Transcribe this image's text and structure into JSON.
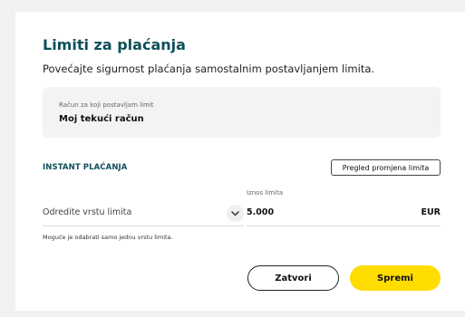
{
  "modal": {
    "title": "Limiti za plaćanja",
    "subtitle": "Povećajte sigurnost plaćanja samostalnim postavljanjem limita."
  },
  "account": {
    "label": "Račun za koji postavljam limit",
    "value": "Moj tekući račun"
  },
  "instant": {
    "section_title": "INSTANT PLAĆANJA",
    "overview_button": "Pregled promjena limita",
    "limit_type": {
      "value": "Odredite vrstu limita",
      "icon": "chevron-down-icon"
    },
    "amount": {
      "label": "Iznos limita",
      "value": "5.000",
      "currency": "EUR"
    },
    "hint": "Moguće je odabrati samo jednu vrstu limita."
  },
  "actions": {
    "close_label": "Zatvori",
    "save_label": "Spremi"
  },
  "colors": {
    "brand_teal": "#0e4f5a",
    "accent_yellow": "#ffdd00"
  }
}
